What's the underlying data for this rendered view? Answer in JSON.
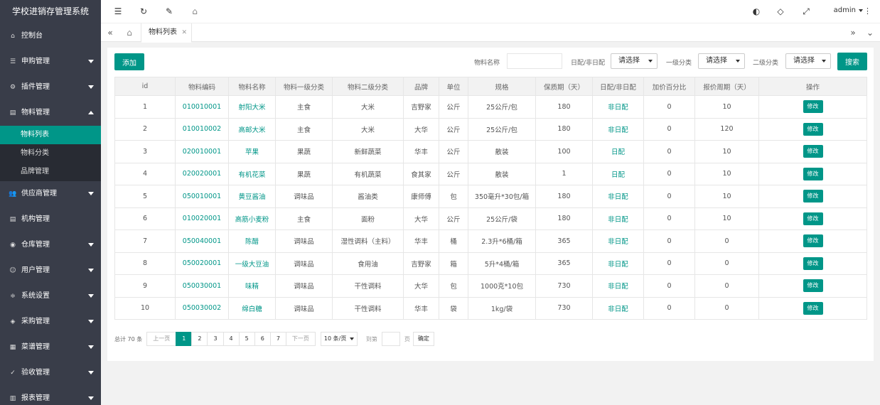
{
  "app": {
    "title": "学校进销存管理系统"
  },
  "sidebar": {
    "items": [
      {
        "label": "控制台",
        "icon": "home-icon",
        "glyph": "⌂",
        "arrow": ""
      },
      {
        "label": "申购管理",
        "icon": "list-icon",
        "glyph": "☰",
        "arrow": "down"
      },
      {
        "label": "插件管理",
        "icon": "settings-icon",
        "glyph": "⚙",
        "arrow": "down"
      },
      {
        "label": "物料管理",
        "icon": "file-icon",
        "glyph": "▤",
        "arrow": "up"
      }
    ],
    "subitems": [
      {
        "label": "物料列表",
        "active": true
      },
      {
        "label": "物料分类",
        "active": false
      },
      {
        "label": "品牌管理",
        "active": false
      }
    ],
    "items2": [
      {
        "label": "供应商管理",
        "icon": "users-icon",
        "glyph": "👥",
        "arrow": "down"
      },
      {
        "label": "机构管理",
        "icon": "file-icon",
        "glyph": "▤",
        "arrow": ""
      },
      {
        "label": "仓库管理",
        "icon": "location-icon",
        "glyph": "◉",
        "arrow": "down"
      },
      {
        "label": "用户管理",
        "icon": "user-icon",
        "glyph": "☺",
        "arrow": "down"
      },
      {
        "label": "系统设置",
        "icon": "sliders-icon",
        "glyph": "≑",
        "arrow": "down"
      },
      {
        "label": "采购管理",
        "icon": "tag-icon",
        "glyph": "◈",
        "arrow": "down"
      },
      {
        "label": "菜谱管理",
        "icon": "book-icon",
        "glyph": "▦",
        "arrow": "down"
      },
      {
        "label": "验收管理",
        "icon": "check-circle-icon",
        "glyph": "✓",
        "arrow": "down"
      },
      {
        "label": "报表管理",
        "icon": "chart-icon",
        "glyph": "▥",
        "arrow": "down"
      }
    ]
  },
  "topbar": {
    "user": "admin"
  },
  "tabs": {
    "active": "物料列表"
  },
  "toolbar": {
    "add_label": "添加",
    "name_label": "物料名称",
    "delivery_label": "日配/非日配",
    "cat1_label": "一级分类",
    "cat2_label": "二级分类",
    "select_placeholder": "请选择",
    "search_label": "搜索"
  },
  "table": {
    "headers": [
      "id",
      "物料编码",
      "物料名称",
      "物料一级分类",
      "物料二级分类",
      "品牌",
      "单位",
      "规格",
      "保质期（天）",
      "日配/非日配",
      "加价百分比",
      "报价周期（天）",
      "操作"
    ],
    "edit_label": "修改",
    "rows": [
      [
        "1",
        "010010001",
        "射阳大米",
        "主食",
        "大米",
        "吉野家",
        "公斤",
        "25公斤/包",
        "180",
        "非日配",
        "0",
        "10"
      ],
      [
        "2",
        "010010002",
        "高邮大米",
        "主食",
        "大米",
        "大华",
        "公斤",
        "25公斤/包",
        "180",
        "非日配",
        "0",
        "120"
      ],
      [
        "3",
        "020010001",
        "苹果",
        "果蔬",
        "新鲜蔬菜",
        "华丰",
        "公斤",
        "散装",
        "100",
        "日配",
        "0",
        "10"
      ],
      [
        "4",
        "020020001",
        "有机花菜",
        "果蔬",
        "有机蔬菜",
        "食其家",
        "公斤",
        "散装",
        "1",
        "日配",
        "0",
        "10"
      ],
      [
        "5",
        "050010001",
        "黄豆酱油",
        "调味品",
        "酱油类",
        "康师傅",
        "包",
        "350毫升*30包/箱",
        "180",
        "非日配",
        "0",
        "10"
      ],
      [
        "6",
        "010020001",
        "高筋小麦粉",
        "主食",
        "面粉",
        "大华",
        "公斤",
        "25公斤/袋",
        "180",
        "非日配",
        "0",
        "10"
      ],
      [
        "7",
        "050040001",
        "陈醋",
        "调味品",
        "湿性调料（主料）",
        "华丰",
        "桶",
        "2.3升*6桶/箱",
        "365",
        "非日配",
        "0",
        "0"
      ],
      [
        "8",
        "050020001",
        "一级大豆油",
        "调味品",
        "食用油",
        "吉野家",
        "箱",
        "5升*4桶/箱",
        "365",
        "非日配",
        "0",
        "0"
      ],
      [
        "9",
        "050030001",
        "味精",
        "调味品",
        "干性调料",
        "大华",
        "包",
        "1000克*10包",
        "730",
        "非日配",
        "0",
        "0"
      ],
      [
        "10",
        "050030002",
        "绵白糖",
        "调味品",
        "干性调料",
        "华丰",
        "袋",
        "1kg/袋",
        "730",
        "非日配",
        "0",
        "0"
      ]
    ]
  },
  "pager": {
    "total": "总计 70 条",
    "prev": "上一页",
    "pages": [
      "1",
      "2",
      "3",
      "4",
      "5",
      "6",
      "7"
    ],
    "current": "1",
    "next": "下一页",
    "per_page": "10 条/页",
    "goto_label": "到第",
    "page_unit": "页",
    "ok": "确定"
  },
  "colors": {
    "accent": "#009688",
    "sidebar": "#393d49",
    "sidebar_sub": "#282b33"
  }
}
